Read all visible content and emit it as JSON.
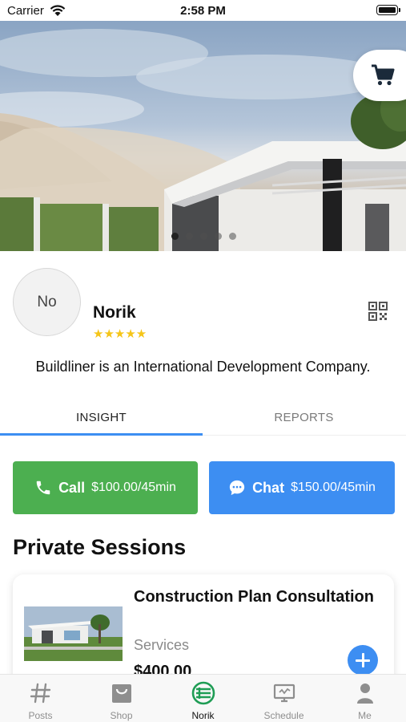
{
  "status_bar": {
    "carrier": "Carrier",
    "time": "2:58 PM"
  },
  "hero": {
    "slide_count": 5,
    "active_slide": 1,
    "cart_icon": "cart-icon"
  },
  "profile": {
    "avatar_initials": "No",
    "name": "Norik",
    "rating_stars": "★★★★★",
    "rating": 5,
    "bio": "Buildliner is an International Development Company.",
    "qr_icon": "qr-code-icon"
  },
  "tabs": [
    {
      "label": "INSIGHT",
      "active": true
    },
    {
      "label": "REPORTS",
      "active": false
    }
  ],
  "actions": {
    "call": {
      "label": "Call",
      "price": "$100.00/45min",
      "color": "#4caf50",
      "icon": "phone-icon"
    },
    "chat": {
      "label": "Chat",
      "price": "$150.00/45min",
      "color": "#3d8ef2",
      "icon": "chat-bubble-icon"
    }
  },
  "private_sessions": {
    "title": "Private Sessions",
    "items": [
      {
        "title": "Construction Plan Consultation",
        "category": "Services",
        "price": "$400.00"
      }
    ]
  },
  "bottom_nav": [
    {
      "label": "Posts",
      "icon": "hash-icon",
      "active": false
    },
    {
      "label": "Shop",
      "icon": "shopping-bag-icon",
      "active": false
    },
    {
      "label": "Norik",
      "icon": "norik-logo-icon",
      "active": true
    },
    {
      "label": "Schedule",
      "icon": "schedule-monitor-icon",
      "active": false
    },
    {
      "label": "Me",
      "icon": "person-icon",
      "active": false
    }
  ],
  "colors": {
    "accent_blue": "#3d8ef2",
    "call_green": "#4caf50",
    "star_gold": "#f5c518",
    "logo_green": "#1f9d55"
  }
}
